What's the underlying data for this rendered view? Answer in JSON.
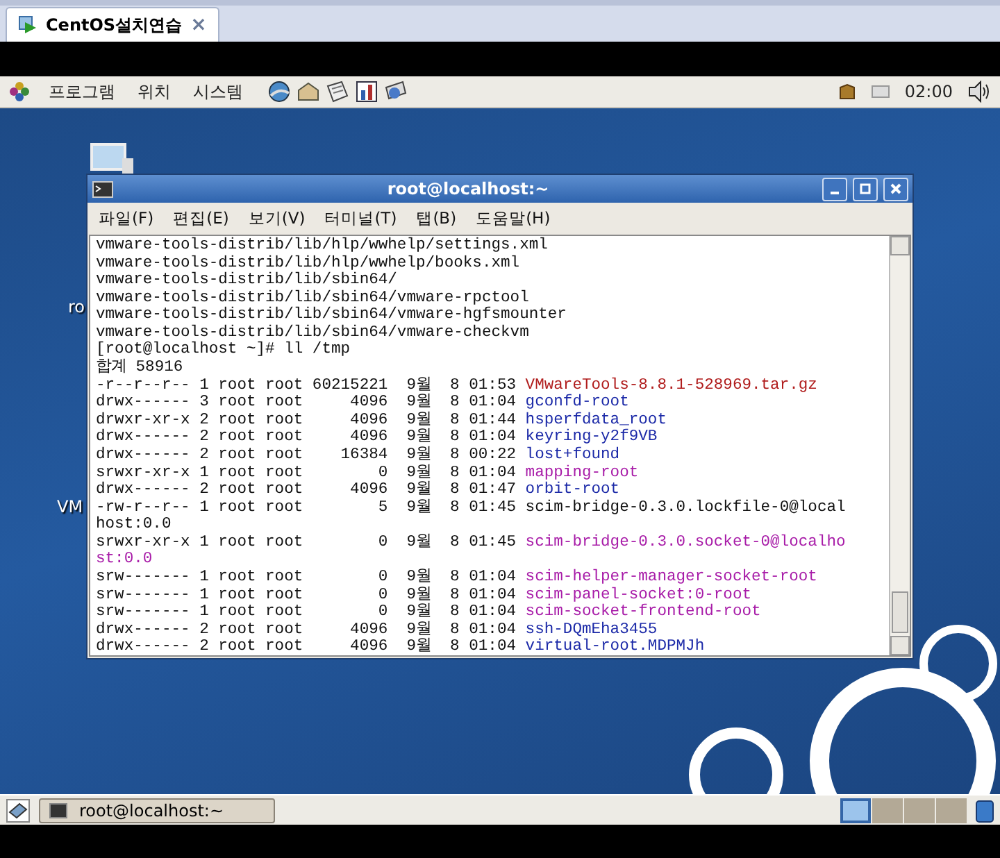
{
  "host_tab": {
    "title": "CentOS설치연습",
    "selected": true,
    "close": "×"
  },
  "top_panel": {
    "menus": [
      "프로그램",
      "위치",
      "시스템"
    ],
    "clock": "02:00"
  },
  "desktop_icons": [
    {
      "label": "ro"
    },
    {
      "label": "VM"
    }
  ],
  "terminal": {
    "title": "root@localhost:~",
    "menus": [
      "파일(F)",
      "편집(E)",
      "보기(V)",
      "터미널(T)",
      "탭(B)",
      "도움말(H)"
    ],
    "lines": [
      {
        "text": "vmware-tools-distrib/lib/hlp/wwhelp/settings.xml"
      },
      {
        "text": "vmware-tools-distrib/lib/hlp/wwhelp/books.xml"
      },
      {
        "text": "vmware-tools-distrib/lib/sbin64/"
      },
      {
        "text": "vmware-tools-distrib/lib/sbin64/vmware-rpctool"
      },
      {
        "text": "vmware-tools-distrib/lib/sbin64/vmware-hgfsmounter"
      },
      {
        "text": "vmware-tools-distrib/lib/sbin64/vmware-checkvm"
      },
      {
        "text": "[root@localhost ~]# ll /tmp"
      },
      {
        "text": "합계 58916"
      },
      {
        "text": "-r--r--r-- 1 root root 60215221  9월  8 01:53 ",
        "name": "VMwareTools-8.8.1-528969.tar.gz",
        "color": "#b01c1c"
      },
      {
        "text": "drwx------ 3 root root     4096  9월  8 01:04 ",
        "name": "gconfd-root",
        "color": "#1c2aa8"
      },
      {
        "text": "drwxr-xr-x 2 root root     4096  9월  8 01:44 ",
        "name": "hsperfdata_root",
        "color": "#1c2aa8"
      },
      {
        "text": "drwx------ 2 root root     4096  9월  8 01:04 ",
        "name": "keyring-y2f9VB",
        "color": "#1c2aa8"
      },
      {
        "text": "drwx------ 2 root root    16384  9월  8 00:22 ",
        "name": "lost+found",
        "color": "#1c2aa8"
      },
      {
        "text": "srwxr-xr-x 1 root root        0  9월  8 01:04 ",
        "name": "mapping-root",
        "color": "#a81ca8"
      },
      {
        "text": "drwx------ 2 root root     4096  9월  8 01:47 ",
        "name": "orbit-root",
        "color": "#1c2aa8"
      },
      {
        "text": "-rw-r--r-- 1 root root        5  9월  8 01:45 scim-bridge-0.3.0.lockfile-0@local"
      },
      {
        "text": "host:0.0"
      },
      {
        "text": "srwxr-xr-x 1 root root        0  9월  8 01:45 ",
        "name": "scim-bridge-0.3.0.socket-0@localho",
        "color": "#a81ca8"
      },
      {
        "name": "st:0.0",
        "color": "#a81ca8"
      },
      {
        "text": "srw------- 1 root root        0  9월  8 01:04 ",
        "name": "scim-helper-manager-socket-root",
        "color": "#a81ca8"
      },
      {
        "text": "srw------- 1 root root        0  9월  8 01:04 ",
        "name": "scim-panel-socket:0-root",
        "color": "#a81ca8"
      },
      {
        "text": "srw------- 1 root root        0  9월  8 01:04 ",
        "name": "scim-socket-frontend-root",
        "color": "#a81ca8"
      },
      {
        "text": "drwx------ 2 root root     4096  9월  8 01:04 ",
        "name": "ssh-DQmEha3455",
        "color": "#1c2aa8"
      },
      {
        "text": "drwx------ 2 root root     4096  9월  8 01:04 ",
        "name": "virtual-root.MDPMJh",
        "color": "#1c2aa8"
      }
    ]
  },
  "bottom_panel": {
    "task": "root@localhost:~",
    "workspaces": [
      {
        "selected": true
      },
      {
        "selected": false
      },
      {
        "selected": false
      },
      {
        "selected": false
      }
    ]
  }
}
